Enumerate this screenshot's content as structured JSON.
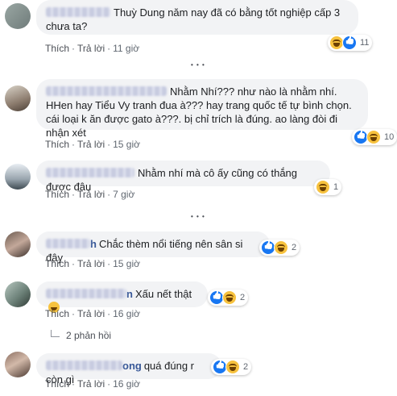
{
  "meta": {
    "like_label": "Thích",
    "reply_label": "Trả lời",
    "separator": "·"
  },
  "comments": [
    {
      "name_tail": "",
      "text": "Thuỳ Dung năm nay đã có bằng tốt nghiệp cấp 3 chưa ta?",
      "time": "11 giờ",
      "reactions": [
        "haha",
        "like"
      ],
      "reaction_count": "11"
    },
    {
      "name_tail": "",
      "text": "Nhằm Nhí??? như nào là nhằm nhí. HHen hay Tiểu Vy tranh đua à??? hay trang quốc tế tự bình chọn. cái loại k ăn được gato à???. bị chỉ trích là đúng. ao làng đòi đi nhận xét",
      "time": "15 giờ",
      "reactions": [
        "like",
        "haha"
      ],
      "reaction_count": "10"
    },
    {
      "name_tail": "",
      "text": "Nhằm nhí mà cô ấy cũng có thắng được đâu",
      "time": "7 giờ",
      "reactions": [
        "haha"
      ],
      "reaction_count": "1"
    },
    {
      "name_tail": "h",
      "text": "Chắc thèm nổi tiếng nên sân si đây",
      "time": "15 giờ",
      "reactions": [
        "like",
        "haha"
      ],
      "reaction_count": "2"
    },
    {
      "name_tail": "n",
      "text": "Xấu nết thật",
      "time": "16 giờ",
      "reactions": [
        "like",
        "haha"
      ],
      "reaction_count": "2",
      "replies_label": "2 phản hồi"
    },
    {
      "name_tail": "ong",
      "text": "quá đúng r còn gì",
      "time": "16 giờ",
      "reactions": [
        "like",
        "haha"
      ],
      "reaction_count": "2"
    }
  ],
  "more_indicator": "• • •"
}
